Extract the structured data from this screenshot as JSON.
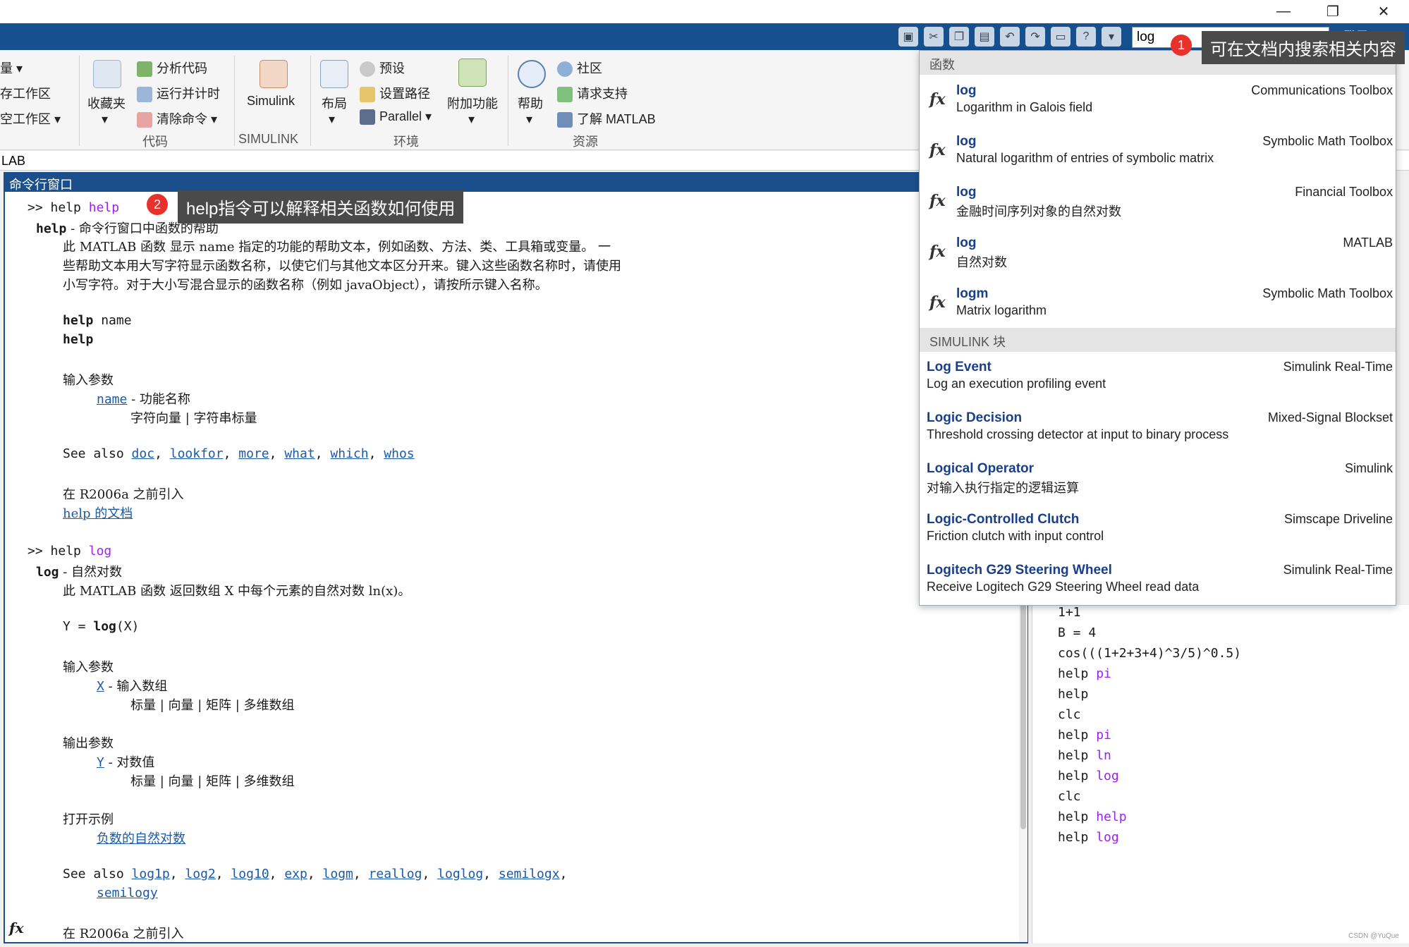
{
  "window": {
    "minimize": "—",
    "maximize": "❐",
    "close": "✕"
  },
  "search": {
    "value": "log",
    "login": "登录"
  },
  "ribbon": {
    "var_menu": "量",
    "save_ws": "存工作区",
    "clear_ws": "空工作区",
    "favorites": "收藏夹",
    "analyze_code": "分析代码",
    "run_time": "运行并计时",
    "clear_cmd": "清除命令",
    "code_section": "代码",
    "simulink": "Simulink",
    "simulink_section": "SIMULINK",
    "layout": "布局",
    "preferences": "预设",
    "set_path": "设置路径",
    "parallel": "Parallel",
    "addons": "附加功能",
    "env_section": "环境",
    "help": "帮助",
    "community": "社区",
    "request_support": "请求支持",
    "learn_matlab": "了解 MATLAB",
    "resources_section": "资源"
  },
  "pathbar": {
    "text": "LAB"
  },
  "cmd": {
    "title": "命令行窗口",
    "prompt": ">>",
    "help_cmd": "help",
    "help_arg": "help",
    "l_help": "help",
    "l_help_desc": " - 命令行窗口中函数的帮助",
    "l_p1": "此 MATLAB 函数 显示 name 指定的功能的帮助文本，例如函数、方法、类、工具箱或变量。 一",
    "l_p2": "些帮助文本用大写字符显示函数名称，以使它们与其他文本区分开来。键入这些函数名称时，请使用",
    "l_p3": "小写字符。对于大小写混合显示的函数名称（例如 javaObject），请按所示键入名称。",
    "syn1_kw": "help",
    "syn1_arg": " name",
    "syn2_kw": "help",
    "in_params": "输入参数",
    "name_link": "name",
    "name_desc": " - 功能名称",
    "name_type": "字符向量 | 字符串标量",
    "see_also": "See also ",
    "see1": [
      "doc",
      "lookfor",
      "more",
      "what",
      "which",
      "whos"
    ],
    "intro": "在 R2006a 之前引入",
    "doc_link": "help 的文档",
    "log_cmd": "help",
    "log_arg": "log",
    "log_name": "log",
    "log_desc": " - 自然对数",
    "log_p1": "此 MATLAB 函数 返回数组 X 中每个元素的自然对数 ln(x)。",
    "log_syn_a": "Y = ",
    "log_syn_b": "log",
    "log_syn_c": "(X)",
    "log_in": "输入参数",
    "x_link": "X",
    "x_desc": " - 输入数组",
    "x_type": "标量 | 向量 | 矩阵 | 多维数组",
    "log_out": "输出参数",
    "y_link": "Y",
    "y_desc": " - 对数值",
    "y_type": "标量 | 向量 | 矩阵 | 多维数组",
    "examples": "打开示例",
    "ex_link": "负数的自然对数",
    "see2": [
      "log1p",
      "log2",
      "log10",
      "exp",
      "logm",
      "reallog",
      "loglog",
      "semilogx"
    ],
    "see2b": "semilogy",
    "log_intro": "在 R2006a 之前引入",
    "fx": "fx"
  },
  "callouts": {
    "c1_num": "1",
    "c1_text": "可在文档内搜索相关内容",
    "c2_num": "2",
    "c2_text": "help指令可以解释相关函数如何使用"
  },
  "dropdown": {
    "functions_header": "函数",
    "functions": [
      {
        "name": "log",
        "desc": "Logarithm in Galois field",
        "product": "Communications Toolbox"
      },
      {
        "name": "log",
        "desc": "Natural logarithm of entries of symbolic matrix",
        "product": "Symbolic Math Toolbox"
      },
      {
        "name": "log",
        "desc": "金融时间序列对象的自然对数",
        "product": "Financial Toolbox"
      },
      {
        "name": "log",
        "desc": "自然对数",
        "product": "MATLAB"
      },
      {
        "name": "logm",
        "desc": "Matrix logarithm",
        "product": "Symbolic Math Toolbox"
      }
    ],
    "simulink_header": "SIMULINK 块",
    "blocks": [
      {
        "name": "Log Event",
        "desc": "Log an execution profiling event",
        "product": "Simulink Real-Time"
      },
      {
        "name": "Logic Decision",
        "desc": "Threshold crossing detector at input to binary process",
        "product": "Mixed-Signal Blockset"
      },
      {
        "name": "Logical Operator",
        "desc": "对输入执行指定的逻辑运算",
        "product": "Simulink"
      },
      {
        "name": "Logic-Controlled Clutch",
        "desc": "Friction clutch with input control",
        "product": "Simscape Driveline"
      },
      {
        "name": "Logitech G29 Steering Wheel",
        "desc": "Receive Logitech G29 Steering Wheel read data",
        "product": "Simulink Real-Time"
      }
    ]
  },
  "history": [
    {
      "cmd": "1+1",
      "arg": ""
    },
    {
      "cmd": "B = 4",
      "arg": ""
    },
    {
      "cmd": "cos(((1+2+3+4)^3/5)^0.5)",
      "arg": ""
    },
    {
      "cmd": "help ",
      "arg": "pi"
    },
    {
      "cmd": "help",
      "arg": ""
    },
    {
      "cmd": "clc",
      "arg": ""
    },
    {
      "cmd": "help ",
      "arg": "pi"
    },
    {
      "cmd": "help ",
      "arg": "ln"
    },
    {
      "cmd": "help ",
      "arg": "log"
    },
    {
      "cmd": "clc",
      "arg": ""
    },
    {
      "cmd": "help ",
      "arg": "help"
    },
    {
      "cmd": "help ",
      "arg": "log"
    }
  ],
  "watermark": "CSDN @YuQue"
}
